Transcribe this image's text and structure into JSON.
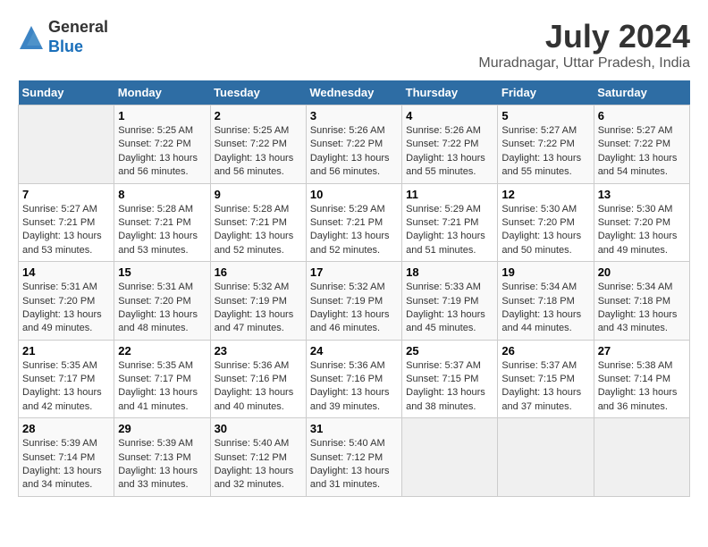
{
  "header": {
    "logo": {
      "line1": "General",
      "line2": "Blue"
    },
    "month": "July 2024",
    "location": "Muradnagar, Uttar Pradesh, India"
  },
  "weekdays": [
    "Sunday",
    "Monday",
    "Tuesday",
    "Wednesday",
    "Thursday",
    "Friday",
    "Saturday"
  ],
  "weeks": [
    [
      {
        "day": "",
        "info": ""
      },
      {
        "day": "1",
        "info": "Sunrise: 5:25 AM\nSunset: 7:22 PM\nDaylight: 13 hours\nand 56 minutes."
      },
      {
        "day": "2",
        "info": "Sunrise: 5:25 AM\nSunset: 7:22 PM\nDaylight: 13 hours\nand 56 minutes."
      },
      {
        "day": "3",
        "info": "Sunrise: 5:26 AM\nSunset: 7:22 PM\nDaylight: 13 hours\nand 56 minutes."
      },
      {
        "day": "4",
        "info": "Sunrise: 5:26 AM\nSunset: 7:22 PM\nDaylight: 13 hours\nand 55 minutes."
      },
      {
        "day": "5",
        "info": "Sunrise: 5:27 AM\nSunset: 7:22 PM\nDaylight: 13 hours\nand 55 minutes."
      },
      {
        "day": "6",
        "info": "Sunrise: 5:27 AM\nSunset: 7:22 PM\nDaylight: 13 hours\nand 54 minutes."
      }
    ],
    [
      {
        "day": "7",
        "info": "Sunrise: 5:27 AM\nSunset: 7:21 PM\nDaylight: 13 hours\nand 53 minutes."
      },
      {
        "day": "8",
        "info": "Sunrise: 5:28 AM\nSunset: 7:21 PM\nDaylight: 13 hours\nand 53 minutes."
      },
      {
        "day": "9",
        "info": "Sunrise: 5:28 AM\nSunset: 7:21 PM\nDaylight: 13 hours\nand 52 minutes."
      },
      {
        "day": "10",
        "info": "Sunrise: 5:29 AM\nSunset: 7:21 PM\nDaylight: 13 hours\nand 52 minutes."
      },
      {
        "day": "11",
        "info": "Sunrise: 5:29 AM\nSunset: 7:21 PM\nDaylight: 13 hours\nand 51 minutes."
      },
      {
        "day": "12",
        "info": "Sunrise: 5:30 AM\nSunset: 7:20 PM\nDaylight: 13 hours\nand 50 minutes."
      },
      {
        "day": "13",
        "info": "Sunrise: 5:30 AM\nSunset: 7:20 PM\nDaylight: 13 hours\nand 49 minutes."
      }
    ],
    [
      {
        "day": "14",
        "info": "Sunrise: 5:31 AM\nSunset: 7:20 PM\nDaylight: 13 hours\nand 49 minutes."
      },
      {
        "day": "15",
        "info": "Sunrise: 5:31 AM\nSunset: 7:20 PM\nDaylight: 13 hours\nand 48 minutes."
      },
      {
        "day": "16",
        "info": "Sunrise: 5:32 AM\nSunset: 7:19 PM\nDaylight: 13 hours\nand 47 minutes."
      },
      {
        "day": "17",
        "info": "Sunrise: 5:32 AM\nSunset: 7:19 PM\nDaylight: 13 hours\nand 46 minutes."
      },
      {
        "day": "18",
        "info": "Sunrise: 5:33 AM\nSunset: 7:19 PM\nDaylight: 13 hours\nand 45 minutes."
      },
      {
        "day": "19",
        "info": "Sunrise: 5:34 AM\nSunset: 7:18 PM\nDaylight: 13 hours\nand 44 minutes."
      },
      {
        "day": "20",
        "info": "Sunrise: 5:34 AM\nSunset: 7:18 PM\nDaylight: 13 hours\nand 43 minutes."
      }
    ],
    [
      {
        "day": "21",
        "info": "Sunrise: 5:35 AM\nSunset: 7:17 PM\nDaylight: 13 hours\nand 42 minutes."
      },
      {
        "day": "22",
        "info": "Sunrise: 5:35 AM\nSunset: 7:17 PM\nDaylight: 13 hours\nand 41 minutes."
      },
      {
        "day": "23",
        "info": "Sunrise: 5:36 AM\nSunset: 7:16 PM\nDaylight: 13 hours\nand 40 minutes."
      },
      {
        "day": "24",
        "info": "Sunrise: 5:36 AM\nSunset: 7:16 PM\nDaylight: 13 hours\nand 39 minutes."
      },
      {
        "day": "25",
        "info": "Sunrise: 5:37 AM\nSunset: 7:15 PM\nDaylight: 13 hours\nand 38 minutes."
      },
      {
        "day": "26",
        "info": "Sunrise: 5:37 AM\nSunset: 7:15 PM\nDaylight: 13 hours\nand 37 minutes."
      },
      {
        "day": "27",
        "info": "Sunrise: 5:38 AM\nSunset: 7:14 PM\nDaylight: 13 hours\nand 36 minutes."
      }
    ],
    [
      {
        "day": "28",
        "info": "Sunrise: 5:39 AM\nSunset: 7:14 PM\nDaylight: 13 hours\nand 34 minutes."
      },
      {
        "day": "29",
        "info": "Sunrise: 5:39 AM\nSunset: 7:13 PM\nDaylight: 13 hours\nand 33 minutes."
      },
      {
        "day": "30",
        "info": "Sunrise: 5:40 AM\nSunset: 7:12 PM\nDaylight: 13 hours\nand 32 minutes."
      },
      {
        "day": "31",
        "info": "Sunrise: 5:40 AM\nSunset: 7:12 PM\nDaylight: 13 hours\nand 31 minutes."
      },
      {
        "day": "",
        "info": ""
      },
      {
        "day": "",
        "info": ""
      },
      {
        "day": "",
        "info": ""
      }
    ]
  ]
}
